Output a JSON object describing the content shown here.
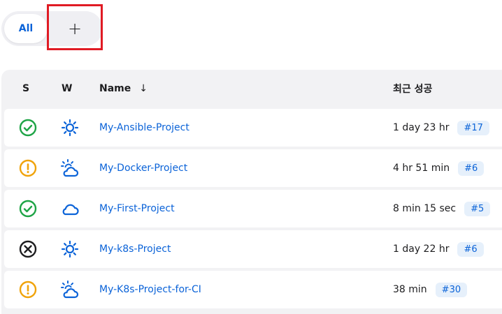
{
  "tabs": {
    "all_label": "All",
    "add_label": "+"
  },
  "table": {
    "headers": {
      "status": "S",
      "weather": "W",
      "name": "Name",
      "sort_arrow": "↓",
      "last_success": "최근 성공"
    },
    "rows": [
      {
        "status": "success",
        "weather": "sunny",
        "name": "My-Ansible-Project",
        "time": "1 day 23 hr",
        "build": "#17"
      },
      {
        "status": "unstable",
        "weather": "partly-cloudy",
        "name": "My-Docker-Project",
        "time": "4 hr 51 min",
        "build": "#6"
      },
      {
        "status": "success",
        "weather": "cloudy",
        "name": "My-First-Project",
        "time": "8 min 15 sec",
        "build": "#5"
      },
      {
        "status": "aborted",
        "weather": "sunny",
        "name": "My-k8s-Project",
        "time": "1 day 22 hr",
        "build": "#6"
      },
      {
        "status": "unstable",
        "weather": "partly-cloudy",
        "name": "My-K8s-Project-for-CI",
        "time": "38 min",
        "build": "#30"
      }
    ]
  },
  "colors": {
    "accent": "#0b63d8",
    "success": "#1ea446",
    "unstable": "#f0a30a",
    "aborted": "#1d1d1f",
    "highlight": "#e01b24"
  }
}
